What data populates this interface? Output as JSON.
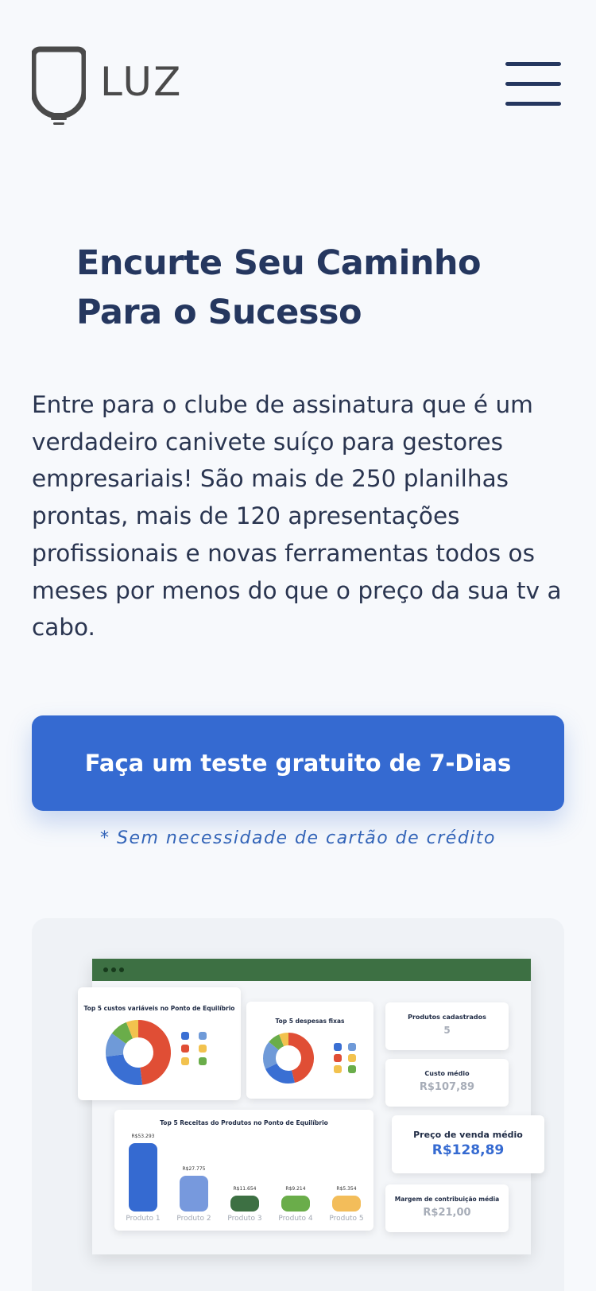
{
  "header": {
    "logo_text": "LUZ"
  },
  "hero": {
    "title": "Encurte Seu Caminho Para o Sucesso",
    "description": "Entre para o clube de assinatura que é um verdadeiro canivete suíço para gestores empresariais! São mais de 250 planilhas prontas, mais de 120 apresentações profissionais e novas ferramentas todos os meses por menos do que o preço da sua tv a cabo.",
    "cta_label": "Faça um teste gratuito de 7-Dias",
    "note": "* Sem necessidade de cartão de crédito"
  },
  "colors": {
    "accent": "#356ad1",
    "heading": "#25375f",
    "dashboard_bar": "#3d7043"
  },
  "dashboard": {
    "donut1_title": "Top 5 custos variáveis no Ponto de Equilíbrio",
    "donut2_title": "Top 5 despesas fixas",
    "kpis": [
      {
        "label": "Produtos cadastrados",
        "value": "5"
      },
      {
        "label": "Custo médio",
        "value": "R$107,89"
      },
      {
        "label": "Preço de venda médio",
        "value": "R$128,89"
      },
      {
        "label": "Margem de contribuição média",
        "value": "R$21,00"
      }
    ],
    "bar_chart_title": "Top 5 Receitas do Produtos no Ponto de Equilíbrio",
    "bars": [
      {
        "label": "Produto 1",
        "value_label": "R$53.293",
        "value": 53293,
        "color": "#356ad1"
      },
      {
        "label": "Produto 2",
        "value_label": "R$27.775",
        "value": 27775,
        "color": "#7799dd"
      },
      {
        "label": "Produto 3",
        "value_label": "R$11.654",
        "value": 11654,
        "color": "#3d7043"
      },
      {
        "label": "Produto 4",
        "value_label": "R$9.214",
        "value": 9214,
        "color": "#6aad4a"
      },
      {
        "label": "Produto 5",
        "value_label": "R$5.354",
        "value": 5354,
        "color": "#f3bd5a"
      }
    ],
    "donut_colors": [
      "#e04e35",
      "#3a6fd3",
      "#6f9ad8",
      "#6aad4a",
      "#f2c24e"
    ]
  }
}
